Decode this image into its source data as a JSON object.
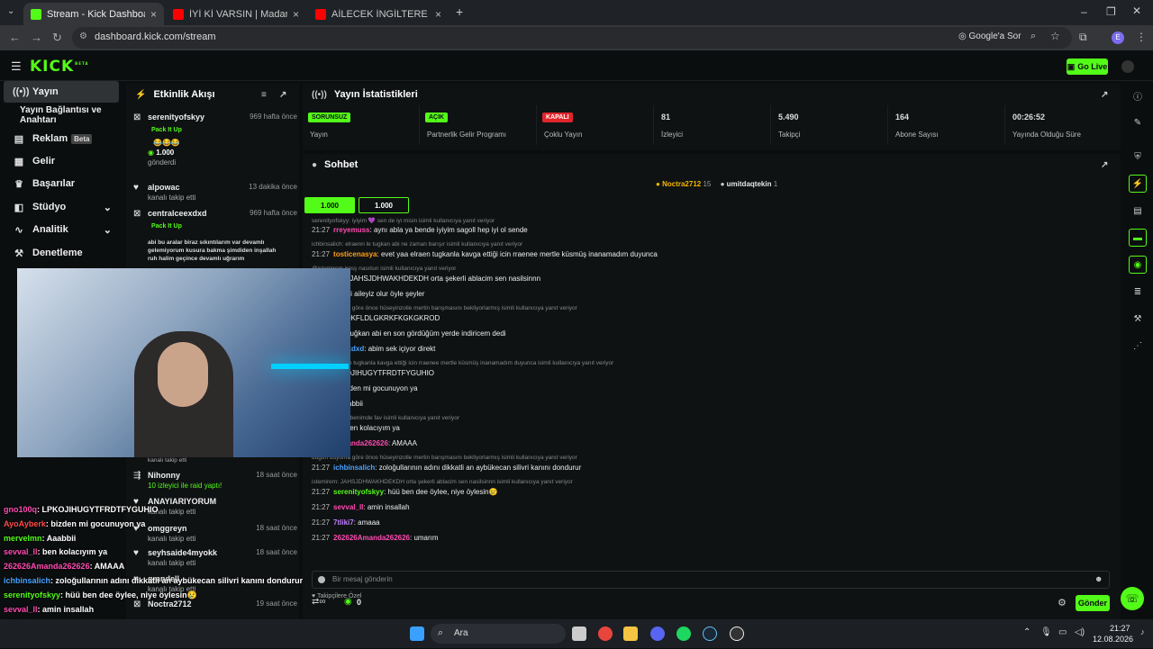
{
  "browser": {
    "tabs": [
      {
        "title": "Stream - Kick Dashboard",
        "favicon": "kick-icon",
        "color": "#53fc18"
      },
      {
        "title": "İYİ Kİ VARSIN | Madara Olduk #",
        "favicon": "youtube-icon",
        "color": "#ff0000"
      },
      {
        "title": "AİLECEK İNGİLTERE GEZİSİ VLO",
        "favicon": "youtube-icon",
        "color": "#ff0000"
      }
    ],
    "url": "dashboard.kick.com/stream",
    "google_lens": "Google'a Sor",
    "profile_initial": "E"
  },
  "kick": {
    "logo": "KICK",
    "logo_sup": "BETA",
    "go_live": "Go Live",
    "accent": "#53fc18"
  },
  "sidebar": {
    "items": [
      {
        "label": "Yayın",
        "icon": "broadcast-icon"
      },
      {
        "label": "Yayın Bağlantısı ve Anahtarı",
        "icon": ""
      },
      {
        "label": "Reklam",
        "icon": "ad-icon",
        "badge": "Beta"
      },
      {
        "label": "Gelir",
        "icon": "revenue-icon"
      },
      {
        "label": "Başarılar",
        "icon": "trophy-icon"
      },
      {
        "label": "Stüdyo",
        "icon": "studio-icon"
      },
      {
        "label": "Analitik",
        "icon": "analytics-icon"
      },
      {
        "label": "Denetleme",
        "icon": "moderation-icon"
      }
    ]
  },
  "activity": {
    "title": "Etkinlik Akışı",
    "items": [
      {
        "name": "serenityofskyy",
        "time": "969 hafta önce",
        "sub": "Pack It Up",
        "amount": "1.000",
        "note": "gönderdi"
      },
      {
        "name": "alpowac",
        "time": "13 dakika önce",
        "sub": "kanalı takip etti"
      },
      {
        "name": "centralceexdxd",
        "time": "969 hafta önce",
        "sub": "Pack It Up",
        "msg": "abi bu aralar biraz sıkıntılarım var devamlı gelemiyorum kusura bakma şimdiden inşallah ruh halim geçince devamlı uğrarım",
        "amount": "1.000"
      },
      {
        "name": "Nihonny",
        "time": "18 saat önce",
        "sub": "10 izleyici ile raid yaptı!"
      },
      {
        "name": "ANAYIARIYORUM",
        "time": "",
        "sub": "kanalı takip etti"
      },
      {
        "name": "omggreyn",
        "time": "18 saat önce",
        "sub": "kanalı takip etti"
      },
      {
        "name": "seyhsaide4myokk",
        "time": "18 saat önce",
        "sub": "kanalı takip etti"
      },
      {
        "name": "grandell",
        "time": "",
        "sub": "kanalı takip etti"
      },
      {
        "name": "Noctra2712",
        "time": "19 saat önce",
        "sub": ""
      }
    ],
    "partial_sub": "kanalı takip etti"
  },
  "stats": {
    "title": "Yayın İstatistikleri",
    "cells": [
      {
        "badge": "SORUNSUZ",
        "badge_color": "#53fc18",
        "label": "Yayın"
      },
      {
        "badge": "AÇIK",
        "badge_color": "#53fc18",
        "label": "Partnerlik Gelir Programı"
      },
      {
        "badge": "KAPALI",
        "badge_color": "#e0252b",
        "label": "Çoklu Yayın"
      },
      {
        "value": "81",
        "label": "İzleyici"
      },
      {
        "value": "5.490",
        "label": "Takipçi"
      },
      {
        "value": "164",
        "label": "Abone Sayısı"
      },
      {
        "value": "00:26:52",
        "label": "Yayında Olduğu Süre"
      }
    ]
  },
  "chat": {
    "title": "Sohbet",
    "top_gifters": [
      {
        "name": "Noctra2712",
        "count": "15"
      },
      {
        "name": "umitdaqtekin",
        "count": "1"
      }
    ],
    "pinned": [
      "1.000",
      "1.000"
    ],
    "lines": [
      {
        "reply": "serenityofskyy: iyiyim 💜 sen de iyi misin isimli kullanıcıya yanıt veriyor"
      },
      {
        "ts": "21:27",
        "user": "rreyemuss",
        "color": "#ff4ab1",
        "text": "aynı abla ya bende iyiyim sagoll hep iyi ol sende"
      },
      {
        "reply": "ichbinsalich: elraenn le tugkan abi ne zaman barışır isimli kullanıcıya yanıt veriyor"
      },
      {
        "ts": "21:27",
        "user": "tosticenasya",
        "color": "#ff9f1a",
        "text": "evet yaa elraen tugkanla kavga ettiği icin rraenee mertle küsmüş inanamadım duyunca"
      },
      {
        "reply": "@istemirem irosş nasılsın isimli kullanıcıya yanıt veriyor"
      },
      {
        "ts": "",
        "user": "istemirem",
        "color": "#c27cff",
        "text": "JAHSJDHWAKHDEKDH orta şekerli ablacim sen nasilsinnn"
      },
      {
        "ts": "",
        "user": "ukenr",
        "color": "#53fc18",
        "text": "biz bi aileyiz olur öyle şeyler"
      },
      {
        "reply": "düğün duyuma göre önce hüseyinzolle mertin barışmasını bekliyorlarmış isimli kullanıcıya yanıt veriyor"
      },
      {
        "ts": "",
        "user": "7tliki7",
        "color": "#c27cff",
        "text": "SKDKFLDLGKRKFKGKGKROD"
      },
      {
        "ts": "",
        "user": "Womer53",
        "color": "#ff4ab1",
        "text": "tuğkan abi en son gördüğüm yerde indiricem dedi"
      },
      {
        "ts": "",
        "user": "centralceexdxd",
        "color": "#4aa3ff",
        "text": "abim sek içiyor direkt"
      },
      {
        "reply": "evet yaa elraen tugkanla kavga ettiği icin rraenee mertle küsmüş inanamadım duyunca isimli kullanıcıya yanıt veriyor"
      },
      {
        "ts": "",
        "user": "100q",
        "color": "#ff4ab1",
        "text": "LPKOJIHUGYTFRDTFYGUHIO"
      },
      {
        "ts": "",
        "user": "Ayberk",
        "color": "#ff4a4a",
        "text": "bizden mi gocunuyon ya"
      },
      {
        "ts": "",
        "user": "rvelmn",
        "color": "#53fc18",
        "text": "Aaabbii"
      },
      {
        "reply": "özel ama be o benimde fav isimli kullanıcıya yanıt veriyor"
      },
      {
        "ts": "",
        "user": "sevval_ll",
        "color": "#ff4ab1",
        "text": "ben kolacıyım ya"
      },
      {
        "ts": "",
        "user": "262626Amanda262626",
        "color": "#ff4ab1",
        "text": "AMAAA"
      },
      {
        "reply": "düğün duyuma göre önce hüseyinzolle mertin barışmasını bekliyorlarmış isimli kullanıcıya yanıt veriyor"
      },
      {
        "ts": "21:27",
        "user": "ichbinsalich",
        "color": "#4aa3ff",
        "text": "zoloğullarının adını dikkatli an aybükecan silivri kanını dondurur"
      },
      {
        "reply": "istemirem: JAHSJDHWAKHDEKDH orta şekerli ablacim sen nasilsinnn isimli kullanıcıya yanıt veriyor"
      },
      {
        "ts": "21:27",
        "user": "serenityofskyy",
        "color": "#53fc18",
        "text": "hüü ben dee öylee, niye öylesin😢"
      },
      {
        "ts": "21:27",
        "user": "sevval_ll",
        "color": "#ff4ab1",
        "text": "amin insallah"
      },
      {
        "ts": "21:27",
        "user": "7tliki7",
        "color": "#c27cff",
        "text": "amaaa"
      },
      {
        "ts": "21:27",
        "user": "262626Amanda262626",
        "color": "#ff4ab1",
        "text": "umarım"
      }
    ],
    "follower_emotes": "Takipçilere Özel",
    "input_placeholder": "Bir mesaj gönderin",
    "points": "0",
    "send": "Gönder"
  },
  "overlay_chat": [
    {
      "user": "gno100q",
      "color": "#ff4ab1",
      "text": ": LPKOJIHUGYTFRDTFYGUHIO"
    },
    {
      "user": "AyoAyberk",
      "color": "#ff4a4a",
      "text": ": bizden mi gocunuyon ya"
    },
    {
      "user": "mervelmn",
      "color": "#53fc18",
      "text": ": Aaabbii"
    },
    {
      "user": "sevval_ll",
      "color": "#ff4ab1",
      "text": ": ben kolacıyım ya"
    },
    {
      "user": "262626Amanda262626",
      "color": "#ff4ab1",
      "text": ": AMAAA"
    },
    {
      "user": "ichbinsalich",
      "color": "#4aa3ff",
      "text": ": zoloğullarının adını dikkatli an aybükecan silivri kanını dondurur"
    },
    {
      "user": "serenityofskyy",
      "color": "#53fc18",
      "text": ": hüü ben dee öylee, niye öylesin😢"
    },
    {
      "user": "sevval_ll",
      "color": "#ff4ab1",
      "text": ": amin insallah"
    },
    {
      "user": "7tliki7",
      "color": "#c27cff",
      "text": ": amaaa"
    },
    {
      "user": "262626Amanda262626",
      "color": "#ff4ab1",
      "text": ": umarım"
    }
  ],
  "taskbar": {
    "search": "Ara",
    "time": "21:27",
    "date": "12.08.2026"
  }
}
